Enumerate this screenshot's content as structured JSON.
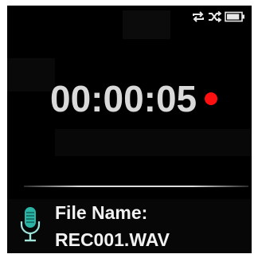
{
  "status": {
    "icons": [
      "repeat-icon",
      "shuffle-icon",
      "battery-icon"
    ],
    "battery_level": 0.9
  },
  "recorder": {
    "elapsed": "00:00:05",
    "recording_indicator_color": "#ff1010"
  },
  "file": {
    "label": "File Name:",
    "name": "REC001.WAV",
    "icon": "microphone-icon"
  },
  "colors": {
    "background": "#000000",
    "timer_text": "#d9d9d9",
    "mic_accent": "#2bb3a3"
  }
}
